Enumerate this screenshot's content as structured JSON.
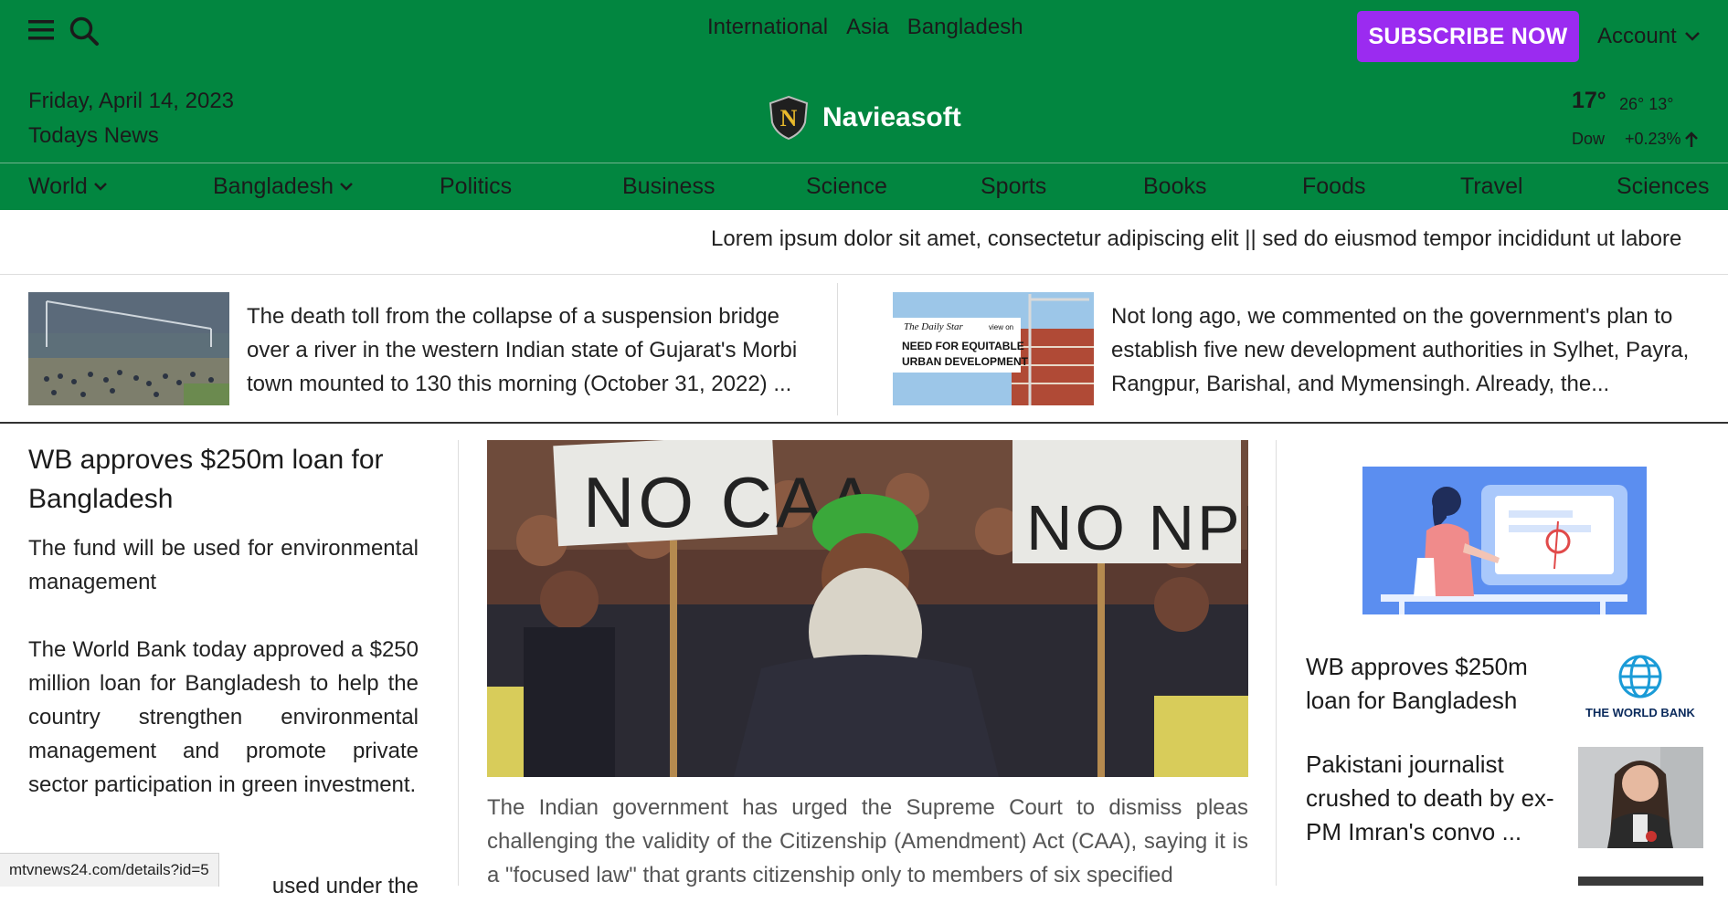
{
  "header": {
    "top_links": [
      "International",
      "Asia",
      "Bangladesh"
    ],
    "subscribe_label": "SUBSCRIBE NOW",
    "account_label": "Account",
    "date": "Friday, April 14, 2023",
    "tagline": "Todays News",
    "brand": "Navieasoft",
    "weather": {
      "temp": "17°",
      "hi_lo": "26° 13°",
      "index_label": "Dow",
      "index_change": "+0.23%"
    }
  },
  "nav": {
    "items": [
      "World",
      "Bangladesh",
      "Politics",
      "Business",
      "Science",
      "Sports",
      "Books",
      "Foods",
      "Travel",
      "Sciences"
    ]
  },
  "ticker": {
    "text": "Lorem ipsum dolor sit amet, consectetur adipiscing elit || sed do eiusmod tempor incididunt ut labore"
  },
  "top_stories": [
    {
      "text": "The death toll from the collapse of a suspension bridge over a river in the western Indian state of Gujarat's Morbi town mounted to 130 this morning (October 31, 2022) ..."
    },
    {
      "text": "Not long ago, we commented on the government's plan to establish five new development authorities in Sylhet, Payra, Rangpur, Barishal, and Mymensingh. Already, the...",
      "thumb_caption_1": "The Daily Star",
      "thumb_caption_2": "view on",
      "thumb_caption_3": "NEED FOR EQUITABLE",
      "thumb_caption_4": "URBAN DEVELOPMENT"
    }
  ],
  "lead": {
    "headline": "WB approves $250m loan for Bangladesh",
    "subhead": "The fund will be used for environmental management",
    "body": "The World Bank today approved a $250 million loan for Bangladesh to help the country strengthen environmental management and promote private sector participation in green investment.",
    "body_fragment": "used under the"
  },
  "center": {
    "photo_sign_1": "NO CAA",
    "photo_sign_2": "NO NPR",
    "caption": "The Indian government has urged the Supreme Court to dismiss pleas challenging the validity of the Citizenship (Amendment) Act (CAA), saying it is a \"focused law\" that grants citizenship only to members of six specified"
  },
  "sidebar": {
    "items": [
      {
        "title": "WB approves $250m loan for Bangladesh",
        "logo_text": "THE WORLD BANK"
      },
      {
        "title": "Pakistani journalist crushed to death by ex-PM Imran's convo ..."
      }
    ]
  },
  "status_url": "mtvnews24.com/details?id=5",
  "colors": {
    "header_green": "#028640",
    "subscribe_purple": "#9b2bf0"
  }
}
